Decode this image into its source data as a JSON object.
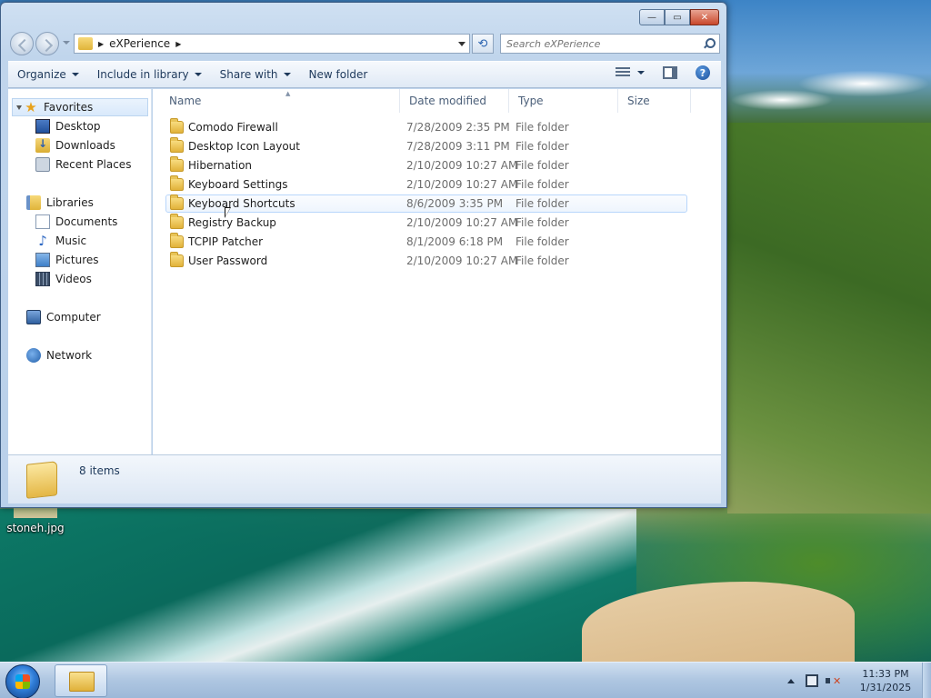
{
  "desktop": {
    "file_label": "stoneh.jpg"
  },
  "window": {
    "caption_minimize": "—",
    "caption_maximize": "▭",
    "caption_close": "✕"
  },
  "address": {
    "path": "eXPerience"
  },
  "search": {
    "placeholder": "Search eXPerience"
  },
  "toolbar": {
    "organize": "Organize",
    "include_in_library": "Include in library",
    "share_with": "Share with",
    "new_folder": "New folder",
    "help": "?"
  },
  "nav": {
    "favorites": "Favorites",
    "desktop": "Desktop",
    "downloads": "Downloads",
    "recent_places": "Recent Places",
    "libraries": "Libraries",
    "documents": "Documents",
    "music": "Music",
    "pictures": "Pictures",
    "videos": "Videos",
    "computer": "Computer",
    "network": "Network"
  },
  "columns": {
    "name": "Name",
    "date_modified": "Date modified",
    "type": "Type",
    "size": "Size"
  },
  "files": [
    {
      "name": "Comodo Firewall",
      "date": "7/28/2009 2:35 PM",
      "type": "File folder"
    },
    {
      "name": "Desktop Icon Layout",
      "date": "7/28/2009 3:11 PM",
      "type": "File folder"
    },
    {
      "name": "Hibernation",
      "date": "2/10/2009 10:27 AM",
      "type": "File folder"
    },
    {
      "name": "Keyboard Settings",
      "date": "2/10/2009 10:27 AM",
      "type": "File folder"
    },
    {
      "name": "Keyboard Shortcuts",
      "date": "8/6/2009 3:35 PM",
      "type": "File folder"
    },
    {
      "name": "Registry Backup",
      "date": "2/10/2009 10:27 AM",
      "type": "File folder"
    },
    {
      "name": "TCPIP Patcher",
      "date": "8/1/2009 6:18 PM",
      "type": "File folder"
    },
    {
      "name": "User Password",
      "date": "2/10/2009 10:27 AM",
      "type": "File folder"
    }
  ],
  "details": {
    "item_count": "8 items"
  },
  "taskbar": {
    "time": "11:33 PM",
    "date": "1/31/2025"
  }
}
